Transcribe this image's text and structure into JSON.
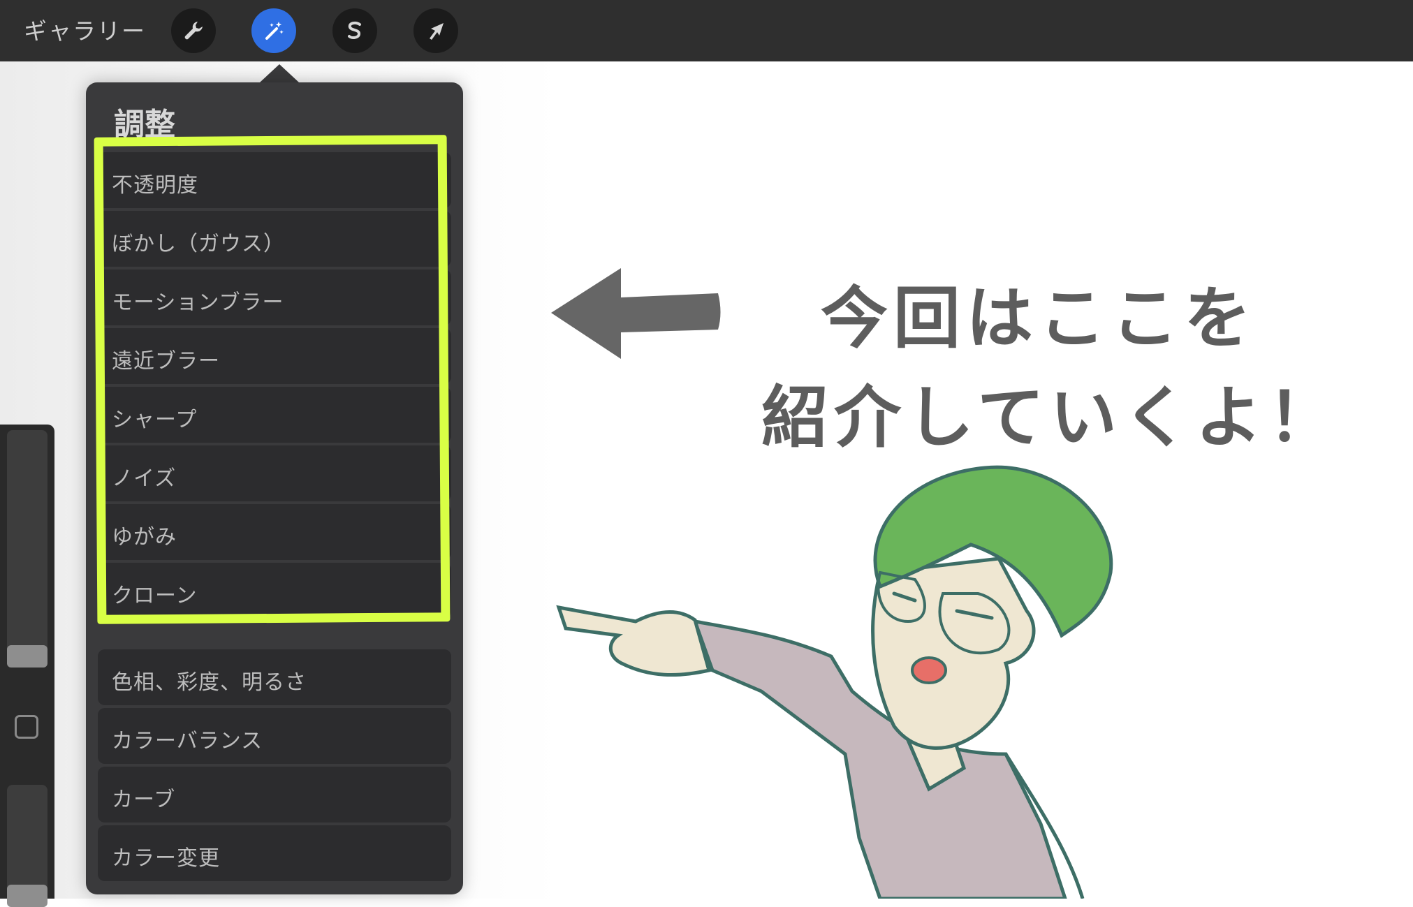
{
  "toolbar": {
    "gallery_label": "ギャラリー",
    "tools": [
      {
        "name": "actions",
        "icon": "wrench-icon",
        "active": false
      },
      {
        "name": "adjustments",
        "icon": "magic-wand-icon",
        "active": true
      },
      {
        "name": "selection",
        "icon": "selection-s-icon",
        "active": false
      },
      {
        "name": "transform",
        "icon": "arrow-cursor-icon",
        "active": false
      }
    ],
    "active_color": "#2f6fe4"
  },
  "panel": {
    "title": "調整",
    "items": [
      {
        "label": "不透明度"
      },
      {
        "label": "ぼかし（ガウス）"
      },
      {
        "label": "モーションブラー"
      },
      {
        "label": "遠近ブラー"
      },
      {
        "label": "シャープ"
      },
      {
        "label": "ノイズ"
      },
      {
        "label": "ゆがみ"
      },
      {
        "label": "クローン"
      },
      {
        "label": "色相、彩度、明るさ"
      },
      {
        "label": "カラーバランス"
      },
      {
        "label": "カーブ"
      },
      {
        "label": "カラー変更"
      }
    ],
    "highlight_color": "#d9ff45"
  },
  "annotation": {
    "line1": "今回はここを",
    "line2": "紹介していくよ！",
    "arrow_color": "#666666"
  },
  "character": {
    "hair_color": "#6ab55a",
    "shirt_color": "#c6b8bd",
    "skin_color": "#efe7d2",
    "outline_color": "#3d6e66"
  }
}
